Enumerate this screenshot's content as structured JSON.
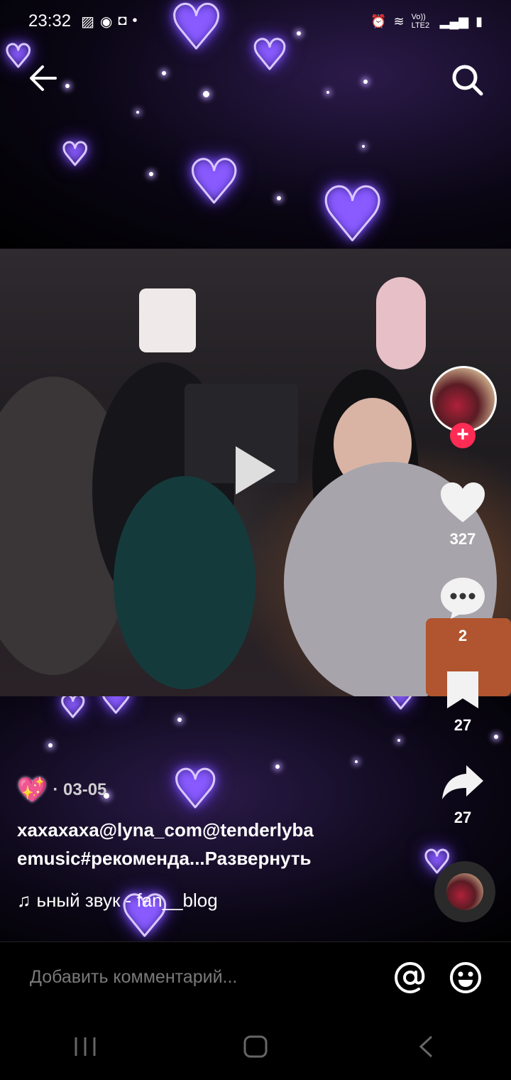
{
  "status_bar": {
    "time": "23:32",
    "left_icons": [
      "image-icon",
      "fingerprint-icon",
      "instagram-icon",
      "dot-icon"
    ],
    "right_icons": [
      "alarm-icon",
      "wifi-icon",
      "volte-icon",
      "signal-icon",
      "battery-icon"
    ],
    "network_label": "Vo)) LTE2"
  },
  "top_nav": {
    "back_icon": "arrow-left-icon",
    "search_icon": "search-icon"
  },
  "video": {
    "state": "paused",
    "play_icon": "play-icon"
  },
  "actions": {
    "follow_icon": "plus-icon",
    "like": {
      "icon": "heart-icon",
      "count": "327"
    },
    "comments": {
      "icon": "comment-icon",
      "count": "2"
    },
    "favorites": {
      "icon": "bookmark-icon",
      "count": "27"
    },
    "shares": {
      "icon": "share-icon",
      "count": "27"
    }
  },
  "caption": {
    "author_badge_icon": "sparkling-heart-icon",
    "date": "· 03-05",
    "description_line1": "хахахаха@lyna_com@tenderlyba",
    "description_line2": "emusic#рекоменда...",
    "expand_label": "Развернуть",
    "music_icon": "music-note-icon",
    "music_text": "ьный звук - fan__blog"
  },
  "comment_bar": {
    "placeholder": "Добавить комментарий...",
    "mention_icon": "at-icon",
    "emoji_icon": "emoji-icon"
  },
  "nav_bar": {
    "recents_icon": "recents-icon",
    "home_icon": "home-icon",
    "back_icon": "back-chevron-icon"
  },
  "colors": {
    "accent": "#fe2c55",
    "heart_glow": "#8a5cff"
  }
}
